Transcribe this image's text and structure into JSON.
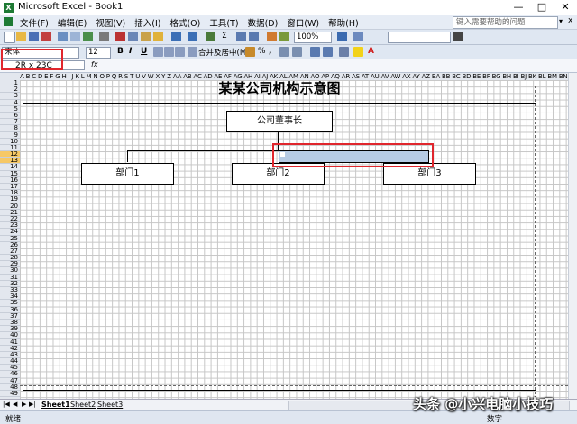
{
  "window": {
    "title": "Microsoft Excel - Book1",
    "app_icon": "X"
  },
  "window_buttons": [
    "—",
    "□",
    "✕"
  ],
  "menu": {
    "items": [
      "文件(F)",
      "编辑(E)",
      "视图(V)",
      "插入(I)",
      "格式(O)",
      "工具(T)",
      "数据(D)",
      "窗口(W)",
      "帮助(H)"
    ],
    "help_placeholder": "键入需要帮助的问题",
    "close": "x"
  },
  "toolbar": {
    "zoom": "100%",
    "font_name": "宋体",
    "font_size": "12",
    "bold": "B",
    "italic": "I",
    "underline": "U",
    "merge_center": "合并及居中(M)",
    "percent": "%",
    "comma": ",",
    "fx": "fx"
  },
  "formula_bar": {
    "name_box": "2R x 23C"
  },
  "grid": {
    "columns": "A B C D E F G H I J K L M N O P Q R S T U V W X Y Z AA AB AC AD AE AF AG AH AI AJ AK AL AM AN AO AP AQ AR AS AT AU AV AW AX AY AZ BA BB BC BD BE BF BG BH BI BJ BK BL BM BN BO BP BQ BR BS BT BU BV BW BX BY BZ CA CB CC CD",
    "rows": [
      "1",
      "2",
      "3",
      "4",
      "5",
      "6",
      "7",
      "8",
      "9",
      "10",
      "11",
      "12",
      "13",
      "14",
      "15",
      "16",
      "17",
      "18",
      "19",
      "20",
      "21",
      "22",
      "23",
      "24",
      "25",
      "26",
      "27",
      "28",
      "29",
      "30",
      "31",
      "32",
      "33",
      "34",
      "35",
      "36",
      "37",
      "38",
      "39",
      "40",
      "41",
      "42",
      "43",
      "44",
      "45",
      "46",
      "47",
      "48",
      "49"
    ],
    "highlighted_rows": [
      "12",
      "13"
    ]
  },
  "sheet": {
    "title": "某某公司机构示意图",
    "org": {
      "chairman": "公司董事长",
      "departments": [
        "部门1",
        "部门2",
        "部门3"
      ]
    }
  },
  "tabs": {
    "nav": [
      "|◀",
      "◀",
      "▶",
      "▶|"
    ],
    "sheets": [
      "Sheet1",
      "Sheet2",
      "Sheet3"
    ]
  },
  "status": {
    "left": "就绪",
    "right": "数字"
  },
  "watermark": "头条 @小兴电脑小技巧",
  "colors": {
    "accent_red": "#e0262d",
    "selection": "#b6cbe4",
    "header_highlight": "#f6c866"
  }
}
